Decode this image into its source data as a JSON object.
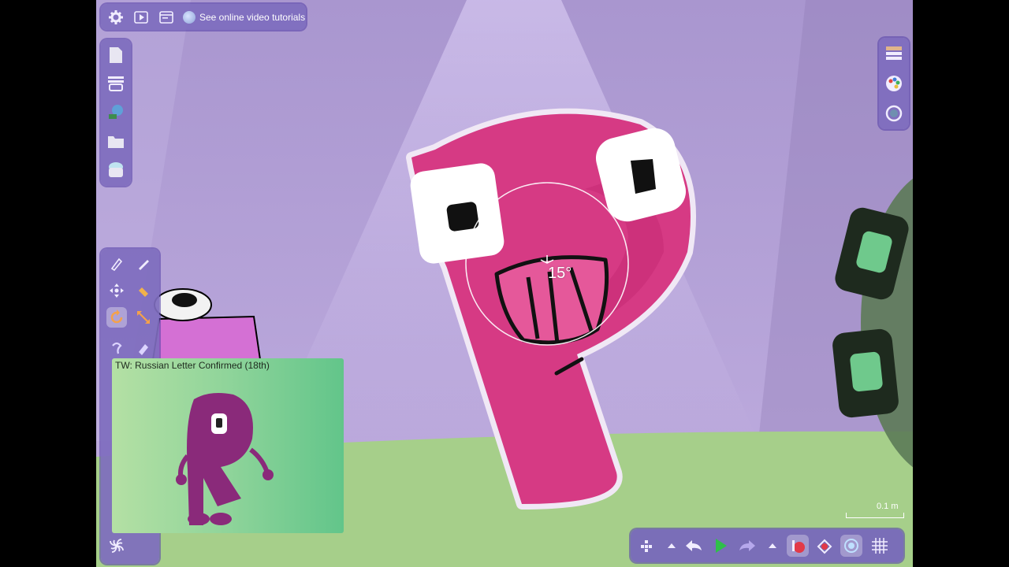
{
  "toolbar": {
    "settings_icon": "gear-icon",
    "play_icon": "play-icon",
    "window_icon": "window-icon",
    "tutorials_label": "See online video tutorials"
  },
  "left_panel": {
    "items": [
      "new-file-icon",
      "layers-icon",
      "character-icon",
      "folder-icon",
      "cloud-icon"
    ]
  },
  "tools": {
    "items": [
      "pen-tool-icon",
      "pencil-tool-icon",
      "move-tool-icon",
      "hand-tool-icon",
      "rotate-tool-icon",
      "scale-tool-icon",
      "bone-tool-icon",
      "smudge-tool-icon"
    ],
    "active": "rotate-tool-icon"
  },
  "right_panel": {
    "items": [
      "timeline-icon",
      "color-palette-icon",
      "search-icon"
    ]
  },
  "canvas": {
    "rotation_readout": "15°",
    "scale_label": "0.1 m"
  },
  "pip": {
    "title": "TW: Russian Letter Confirmed (18th)"
  },
  "bottom_bar": {
    "items": [
      "grid-dots-icon",
      "caret-up-icon",
      "undo-icon",
      "play-icon",
      "redo-icon",
      "caret-up-icon",
      "apple-icon",
      "onion-skin-icon",
      "camera-icon",
      "grid-icon"
    ]
  },
  "colors": {
    "panel": "#7e6cbe",
    "character": "#d63a84",
    "ground": "#a6cf8a",
    "background": "#b7a2d8"
  }
}
